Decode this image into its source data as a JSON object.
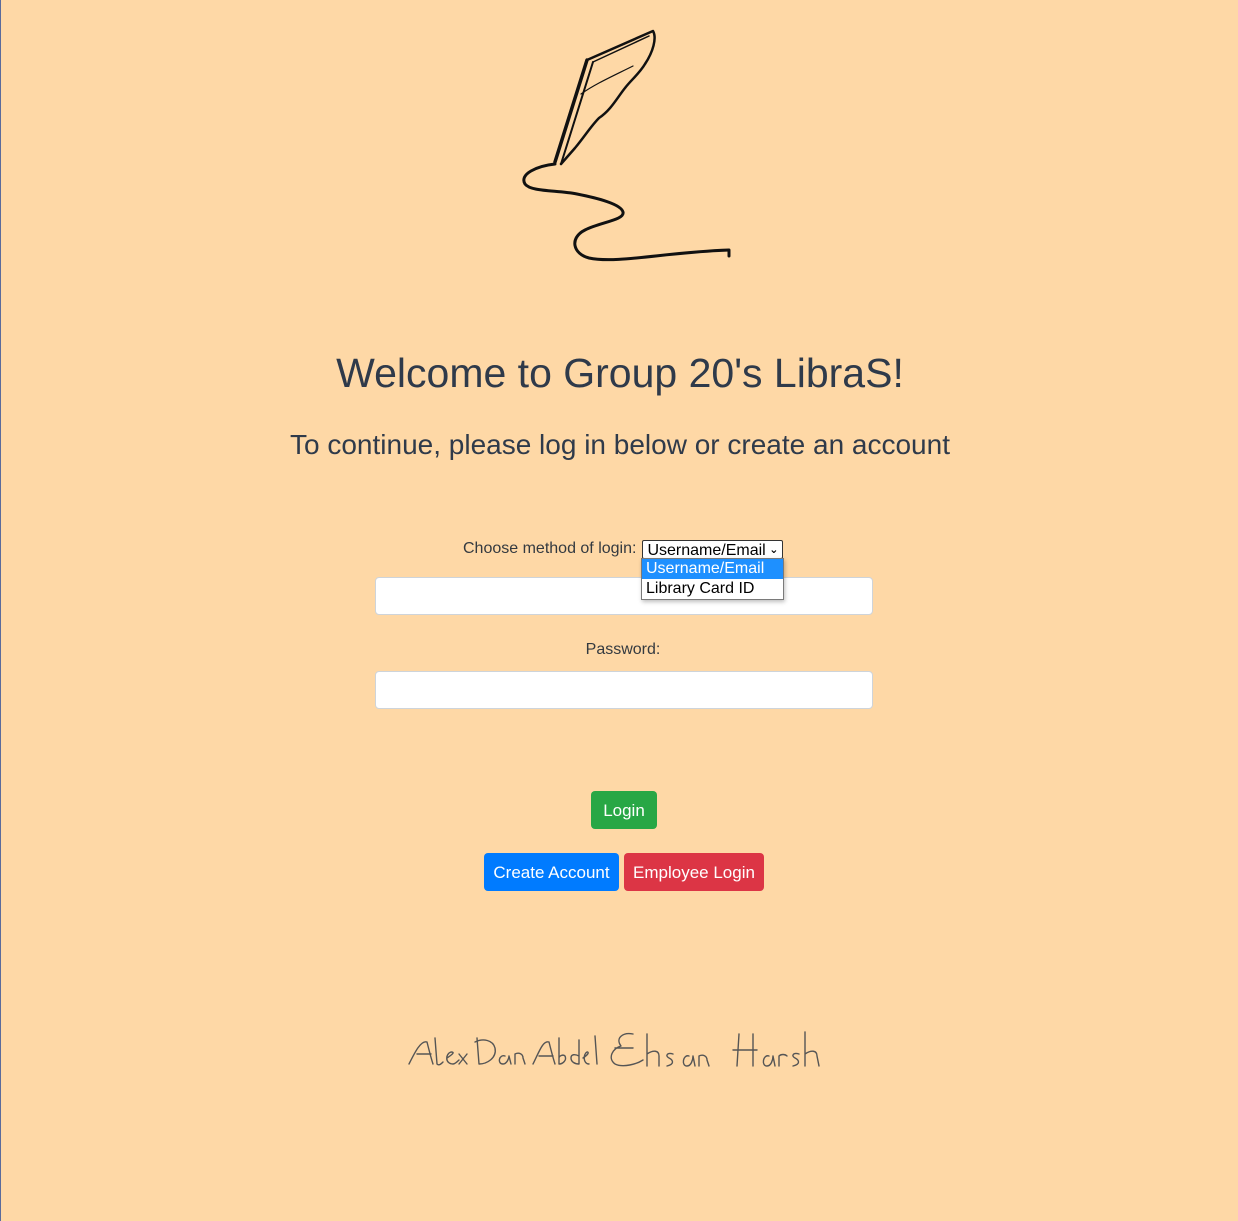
{
  "header": {
    "title": "Welcome to Group 20's LibraS!",
    "subtitle": "To continue, please log in below or create an account"
  },
  "login_form": {
    "method_label": "Choose method of login:",
    "method_selected": "Username/Email",
    "method_options": [
      "Username/Email",
      "Library Card ID"
    ],
    "username_value": "",
    "password_label": "Password:",
    "password_value": ""
  },
  "buttons": {
    "login": "Login",
    "create_account": "Create Account",
    "employee_login": "Employee Login"
  },
  "footer": {
    "signature_names": "Alex Dan Abdel Ehsan Harsh"
  },
  "colors": {
    "background": "#fed8a6",
    "login_button": "#28a745",
    "create_button": "#007bff",
    "employee_button": "#dc3545",
    "selected_option": "#1e90ff"
  },
  "icons": {
    "logo": "quill-pen-logo",
    "select_arrow": "chevron-down-icon"
  }
}
